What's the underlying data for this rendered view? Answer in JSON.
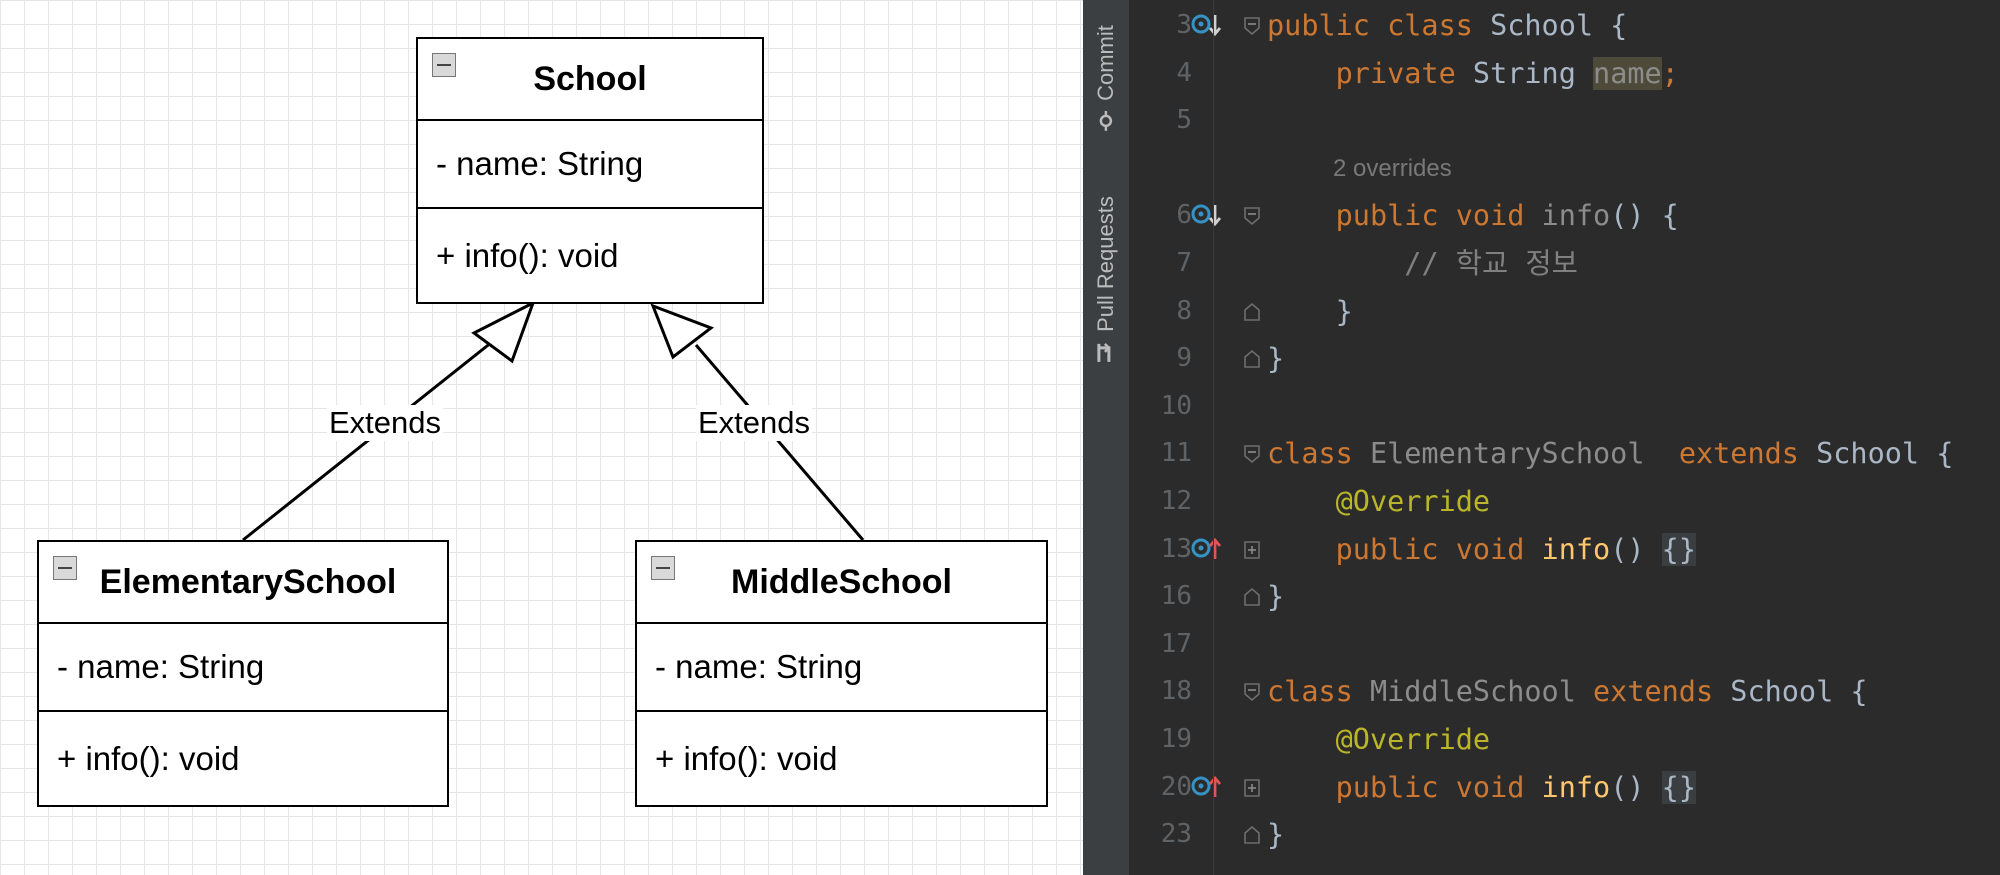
{
  "diagram": {
    "classes": [
      {
        "id": "school",
        "name": "School",
        "attribute": "- name: String",
        "operation": "+ info(): void"
      },
      {
        "id": "elementary",
        "name": "ElementarySchool",
        "attribute": "- name: String",
        "operation": "+ info(): void"
      },
      {
        "id": "middle",
        "name": "MiddleSchool",
        "attribute": "- name: String",
        "operation": "+ info(): void"
      }
    ],
    "edges": [
      {
        "from": "elementary",
        "to": "school",
        "label": "Extends"
      },
      {
        "from": "middle",
        "to": "school",
        "label": "Extends"
      }
    ]
  },
  "ide": {
    "tool_tabs": [
      {
        "label": "Commit",
        "icon": "commit-icon"
      },
      {
        "label": "Pull Requests",
        "icon": "pull-request-icon"
      }
    ],
    "inlay_hint": "2 overrides",
    "code_lines": [
      {
        "num": "3",
        "icon": "override-down",
        "fold": "open",
        "tokens": [
          [
            "kw",
            "public class "
          ],
          [
            "",
            "School {"
          ]
        ]
      },
      {
        "num": "4",
        "icon": "",
        "fold": "",
        "tokens": [
          [
            "",
            "    "
          ],
          [
            "kw",
            "private "
          ],
          [
            "",
            "String "
          ],
          [
            "hl",
            "name"
          ],
          [
            "kw",
            ";"
          ]
        ]
      },
      {
        "num": "5",
        "icon": "",
        "fold": "",
        "tokens": []
      },
      {
        "num": "6",
        "icon": "override-down",
        "fold": "open",
        "tokens": [
          [
            "",
            "    "
          ],
          [
            "kw",
            "public void "
          ],
          [
            "unused",
            "info"
          ],
          [
            "",
            "() {"
          ]
        ]
      },
      {
        "num": "7",
        "icon": "",
        "fold": "",
        "tokens": [
          [
            "",
            "        "
          ],
          [
            "cm",
            "// 학교 정보"
          ]
        ]
      },
      {
        "num": "8",
        "icon": "",
        "fold": "close",
        "tokens": [
          [
            "",
            "    }"
          ]
        ]
      },
      {
        "num": "9",
        "icon": "",
        "fold": "close",
        "tokens": [
          [
            "",
            "}"
          ]
        ]
      },
      {
        "num": "10",
        "icon": "",
        "fold": "",
        "tokens": []
      },
      {
        "num": "11",
        "icon": "",
        "fold": "open",
        "tokens": [
          [
            "kw",
            "class "
          ],
          [
            "unused",
            "ElementarySchool  "
          ],
          [
            "kw",
            "extends "
          ],
          [
            "",
            "School {"
          ]
        ]
      },
      {
        "num": "12",
        "icon": "",
        "fold": "",
        "tokens": [
          [
            "",
            "    "
          ],
          [
            "an",
            "@Override"
          ]
        ]
      },
      {
        "num": "13",
        "icon": "override-up",
        "fold": "collapsed",
        "tokens": [
          [
            "",
            "    "
          ],
          [
            "kw",
            "public void "
          ],
          [
            "fn",
            "info"
          ],
          [
            "",
            "() "
          ],
          [
            "fbox",
            "{}"
          ]
        ]
      },
      {
        "num": "16",
        "icon": "",
        "fold": "close",
        "tokens": [
          [
            "",
            "}"
          ]
        ]
      },
      {
        "num": "17",
        "icon": "",
        "fold": "",
        "tokens": []
      },
      {
        "num": "18",
        "icon": "",
        "fold": "open",
        "tokens": [
          [
            "kw",
            "class "
          ],
          [
            "unused",
            "MiddleSchool "
          ],
          [
            "kw",
            "extends "
          ],
          [
            "",
            "School {"
          ]
        ]
      },
      {
        "num": "19",
        "icon": "",
        "fold": "",
        "tokens": [
          [
            "",
            "    "
          ],
          [
            "an",
            "@Override"
          ]
        ]
      },
      {
        "num": "20",
        "icon": "override-up",
        "fold": "collapsed",
        "tokens": [
          [
            "",
            "    "
          ],
          [
            "kw",
            "public void "
          ],
          [
            "fn",
            "info"
          ],
          [
            "",
            "() "
          ],
          [
            "fbox",
            "{}"
          ]
        ]
      },
      {
        "num": "23",
        "icon": "",
        "fold": "close",
        "tokens": [
          [
            "",
            "}"
          ]
        ]
      }
    ],
    "colors": {
      "background": "#2b2b2b",
      "keyword": "#cc7832",
      "function": "#ffc66d",
      "annotation": "#bbb529",
      "comment": "#808080",
      "text": "#a9b7c6",
      "override_icon": "#3592c4",
      "override_arrow_up": "#e05555"
    }
  }
}
